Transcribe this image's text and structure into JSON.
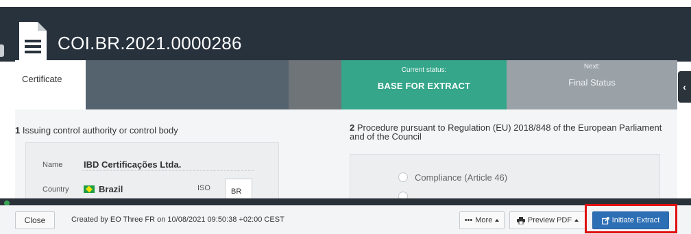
{
  "header": {
    "title": "COI.BR.2021.0000286"
  },
  "tabs": {
    "certificate": "Certificate",
    "current_label": "Current status:",
    "current_value": "BASE FOR EXTRACT",
    "next_label": "Next:",
    "next_value": "Final Status"
  },
  "section1": {
    "number": "1",
    "title": "Issuing control authority or control body",
    "name_label": "Name",
    "name_value": "IBD Certificações Ltda.",
    "country_label": "Country",
    "country_value": "Brazil",
    "iso_label": "ISO",
    "iso_value": "BR"
  },
  "section2": {
    "number": "2",
    "title": "Procedure pursuant to Regulation (EU) 2018/848 of the European Parliament and of the Council",
    "option1": "Compliance (Article 46)"
  },
  "footer": {
    "close_label": "Close",
    "created_text": "Created by EO Three FR on 10/08/2021 09:50:38 +02:00 CEST",
    "more_label": "More",
    "preview_label": "Preview PDF",
    "extract_label": "Initiate Extract"
  },
  "colors": {
    "header_bg": "#27323d",
    "current_status": "#35a68a",
    "next_status": "#9aa1a7",
    "primary_button": "#2d6fb5",
    "highlight": "#e01010"
  }
}
